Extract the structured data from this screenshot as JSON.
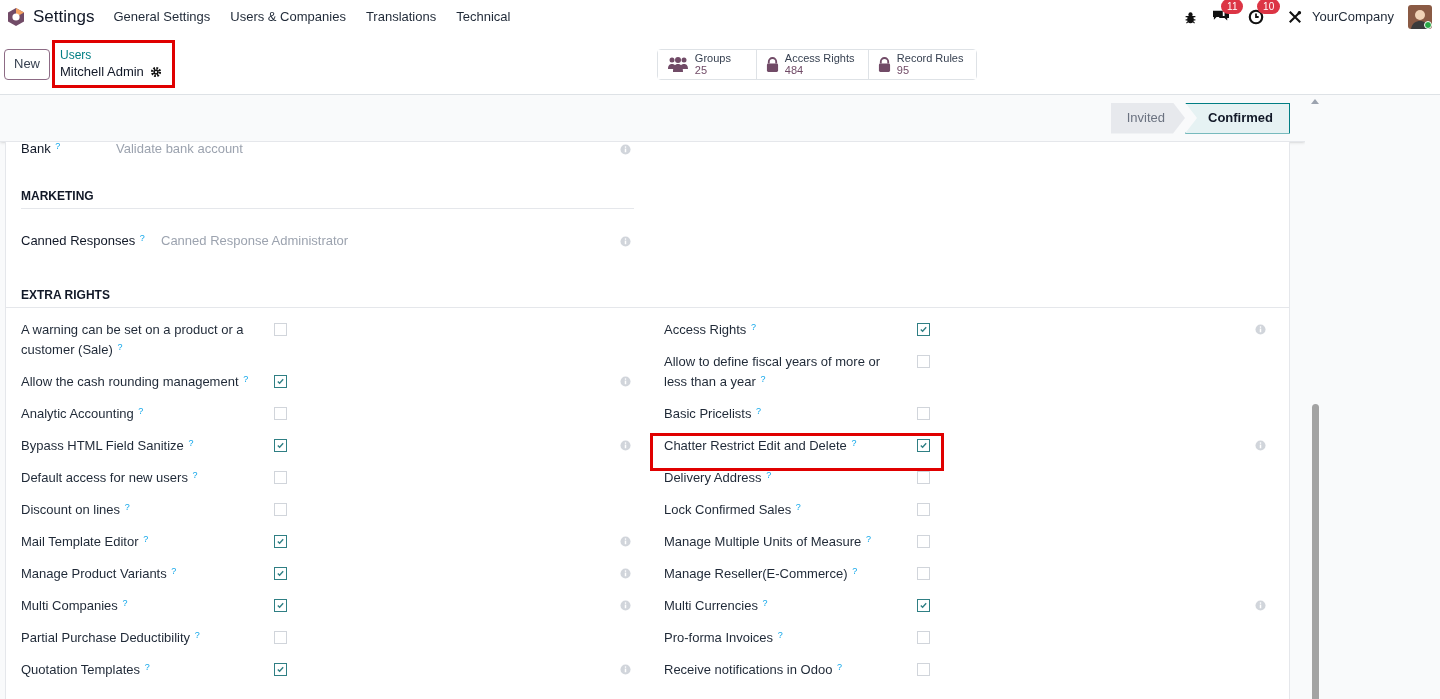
{
  "navbar": {
    "app": "Settings",
    "menu": [
      "General Settings",
      "Users & Companies",
      "Translations",
      "Technical"
    ],
    "messages_badge": "11",
    "activities_badge": "10",
    "company": "YourCompany"
  },
  "control_panel": {
    "new_button": "New",
    "breadcrumb": {
      "parent": "Users",
      "current": "Mitchell Admin",
      "highlighted": true
    },
    "smart_buttons": [
      {
        "kind": "groups",
        "label": "Groups",
        "value": "25"
      },
      {
        "kind": "lock",
        "label": "Access Rights",
        "value": "484"
      },
      {
        "kind": "lock",
        "label": "Record Rules",
        "value": "95"
      }
    ]
  },
  "status_bar": [
    {
      "label": "Invited",
      "selected": false
    },
    {
      "label": "Confirmed",
      "selected": true
    }
  ],
  "bank_field": {
    "label": "Bank $^{?}$",
    "placeholder": "Validate bank account"
  },
  "marketing": {
    "title": "MARKETING",
    "field": {
      "label": "Canned Responses $^{?}$",
      "value": "Canned Response Administrator"
    }
  },
  "extra_rights": {
    "title": "EXTRA RIGHTS",
    "left": [
      {
        "label": "A warning can be set on a product or a customer (Sale) $^{?}$",
        "checked": false,
        "info": false,
        "highlighted": false
      },
      {
        "label": "Allow the cash rounding management $^{?}$",
        "checked": true,
        "info": true,
        "highlighted": false
      },
      {
        "label": "Analytic Accounting $^{?}$",
        "checked": false,
        "info": false,
        "highlighted": false
      },
      {
        "label": "Bypass HTML Field Sanitize $^{?}$",
        "checked": true,
        "info": true,
        "highlighted": false
      },
      {
        "label": "Default access for new users $^{?}$",
        "checked": false,
        "info": false,
        "highlighted": false
      },
      {
        "label": "Discount on lines $^{?}$",
        "checked": false,
        "info": false,
        "highlighted": false
      },
      {
        "label": "Mail Template Editor $^{?}$",
        "checked": true,
        "info": true,
        "highlighted": false
      },
      {
        "label": "Manage Product Variants $^{?}$",
        "checked": true,
        "info": true,
        "highlighted": false
      },
      {
        "label": "Multi Companies $^{?}$",
        "checked": true,
        "info": true,
        "highlighted": false
      },
      {
        "label": "Partial Purchase Deductibility $^{?}$",
        "checked": false,
        "info": false,
        "highlighted": false
      },
      {
        "label": "Quotation Templates $^{?}$",
        "checked": true,
        "info": true,
        "highlighted": false
      }
    ],
    "right": [
      {
        "label": "Access Rights $^{?}$",
        "checked": true,
        "info": true,
        "highlighted": false
      },
      {
        "label": "Allow to define fiscal years of more or less than a year $^{?}$",
        "checked": false,
        "info": false,
        "highlighted": false
      },
      {
        "label": "Basic Pricelists $^{?}$",
        "checked": false,
        "info": false,
        "highlighted": false
      },
      {
        "label": "Chatter Restrict Edit and Delete $^{?}$",
        "checked": true,
        "info": true,
        "highlighted": true
      },
      {
        "label": "Delivery Address $^{?}$",
        "checked": false,
        "info": false,
        "highlighted": false
      },
      {
        "label": "Lock Confirmed Sales $^{?}$",
        "checked": false,
        "info": false,
        "highlighted": false
      },
      {
        "label": "Manage Multiple Units of Measure $^{?}$",
        "checked": false,
        "info": false,
        "highlighted": false
      },
      {
        "label": "Manage Reseller(E-Commerce) $^{?}$",
        "checked": false,
        "info": false,
        "highlighted": false
      },
      {
        "label": "Multi Currencies $^{?}$",
        "checked": true,
        "info": true,
        "highlighted": false
      },
      {
        "label": "Pro-forma Invoices $^{?}$",
        "checked": false,
        "info": false,
        "highlighted": false
      },
      {
        "label": "Receive notifications in Odoo $^{?}$",
        "checked": false,
        "info": false,
        "highlighted": false
      }
    ]
  }
}
